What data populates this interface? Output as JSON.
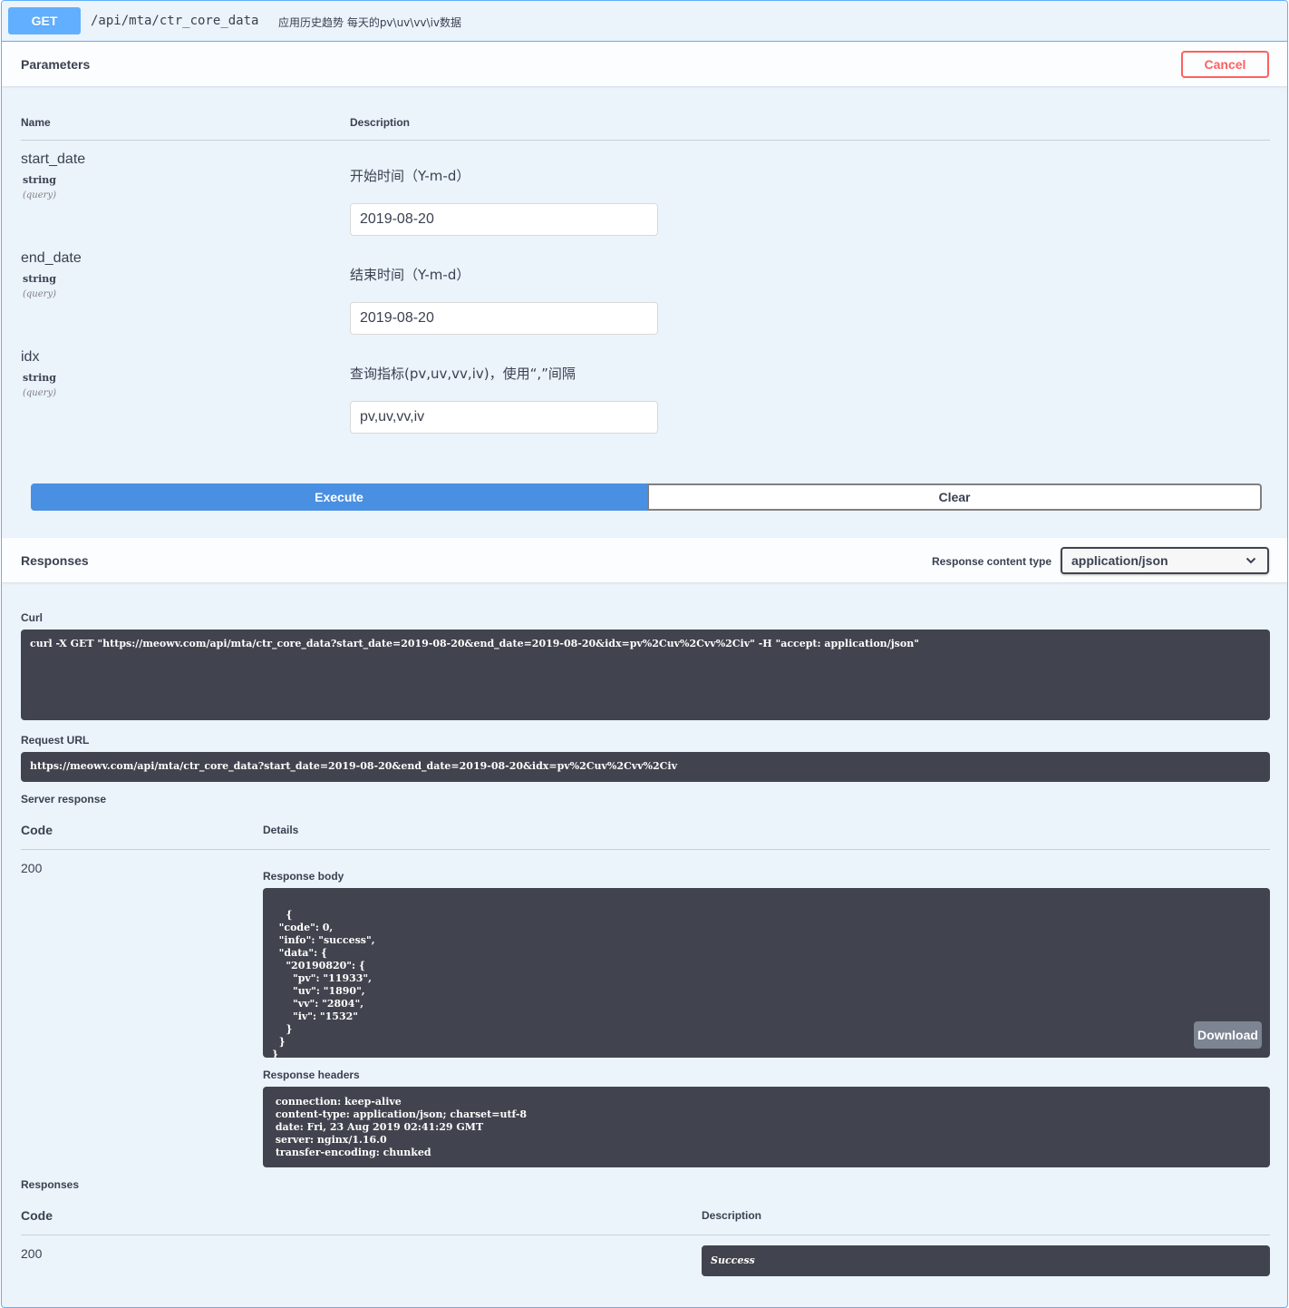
{
  "summary": {
    "method": "GET",
    "path": "/api/mta/ctr_core_data",
    "description": "应用历史趋势 每天的pv\\uv\\vv\\iv数据"
  },
  "parameters_section": {
    "title": "Parameters",
    "cancel_label": "Cancel",
    "col_name": "Name",
    "col_description": "Description",
    "params": [
      {
        "name": "start_date",
        "type": "string",
        "in": "(query)",
        "description": "开始时间（Y-m-d）",
        "value": "2019-08-20"
      },
      {
        "name": "end_date",
        "type": "string",
        "in": "(query)",
        "description": "结束时间（Y-m-d）",
        "value": "2019-08-20"
      },
      {
        "name": "idx",
        "type": "string",
        "in": "(query)",
        "description": "查询指标(pv,uv,vv,iv)，使用“,”间隔",
        "value": "pv,uv,vv,iv"
      }
    ],
    "execute_label": "Execute",
    "clear_label": "Clear"
  },
  "responses_section": {
    "title": "Responses",
    "content_type_label": "Response content type",
    "content_type_value": "application/json",
    "curl_label": "Curl",
    "curl": "curl -X GET \"https://meowv.com/api/mta/ctr_core_data?start_date=2019-08-20&end_date=2019-08-20&idx=pv%2Cuv%2Cvv%2Civ\" -H \"accept: application/json\"",
    "request_url_label": "Request URL",
    "request_url": "https://meowv.com/api/mta/ctr_core_data?start_date=2019-08-20&end_date=2019-08-20&idx=pv%2Cuv%2Cvv%2Civ",
    "server_response_label": "Server response",
    "code_col": "Code",
    "details_col": "Details",
    "code": "200",
    "response_body_label": "Response body",
    "response_body": "{\n  \"code\": 0,\n  \"info\": \"success\",\n  \"data\": {\n    \"20190820\": {\n      \"pv\": \"11933\",\n      \"uv\": \"1890\",\n      \"vv\": \"2804\",\n      \"iv\": \"1532\"\n    }\n  }\n}",
    "download_label": "Download",
    "response_headers_label": "Response headers",
    "response_headers": " connection: keep-alive \n content-type: application/json; charset=utf-8 \n date: Fri, 23 Aug 2019 02:41:29 GMT \n server: nginx/1.16.0 \n transfer-encoding: chunked "
  },
  "documented_responses": {
    "title": "Responses",
    "code_col": "Code",
    "description_col": "Description",
    "code": "200",
    "description": "Success"
  },
  "colors": {
    "get_accent": "#61affe",
    "get_background": "#ebf3fb",
    "execute": "#4990e2",
    "cancel": "#ff6060",
    "code_background": "#41444e"
  }
}
